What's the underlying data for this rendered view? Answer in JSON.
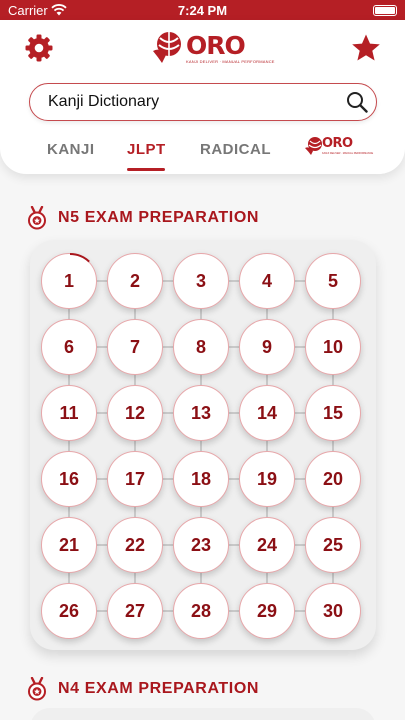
{
  "status_bar": {
    "carrier": "Carrier",
    "time": "7:24 PM"
  },
  "header": {
    "logo_text": "ORO",
    "logo_tagline": "KANJI DELIVER · MANUAL PERFORMANCE",
    "search": {
      "placeholder": "Kanji Dictionary",
      "value": ""
    }
  },
  "tabs": [
    {
      "label": "KANJI",
      "active": false
    },
    {
      "label": "JLPT",
      "active": true
    },
    {
      "label": "RADICAL",
      "active": false
    }
  ],
  "sections": [
    {
      "title": "N5 EXAM PREPARATION",
      "days": [
        "1",
        "2",
        "3",
        "4",
        "5",
        "6",
        "7",
        "8",
        "9",
        "10",
        "11",
        "12",
        "13",
        "14",
        "15",
        "16",
        "17",
        "18",
        "19",
        "20",
        "21",
        "22",
        "23",
        "24",
        "25",
        "26",
        "27",
        "28",
        "29",
        "30"
      ],
      "first_day_progress": 0.12
    },
    {
      "title": "N4 EXAM PREPARATION"
    }
  ],
  "colors": {
    "accent": "#b51f25",
    "day_text": "#8b0f14",
    "tab_inactive": "#777777"
  }
}
